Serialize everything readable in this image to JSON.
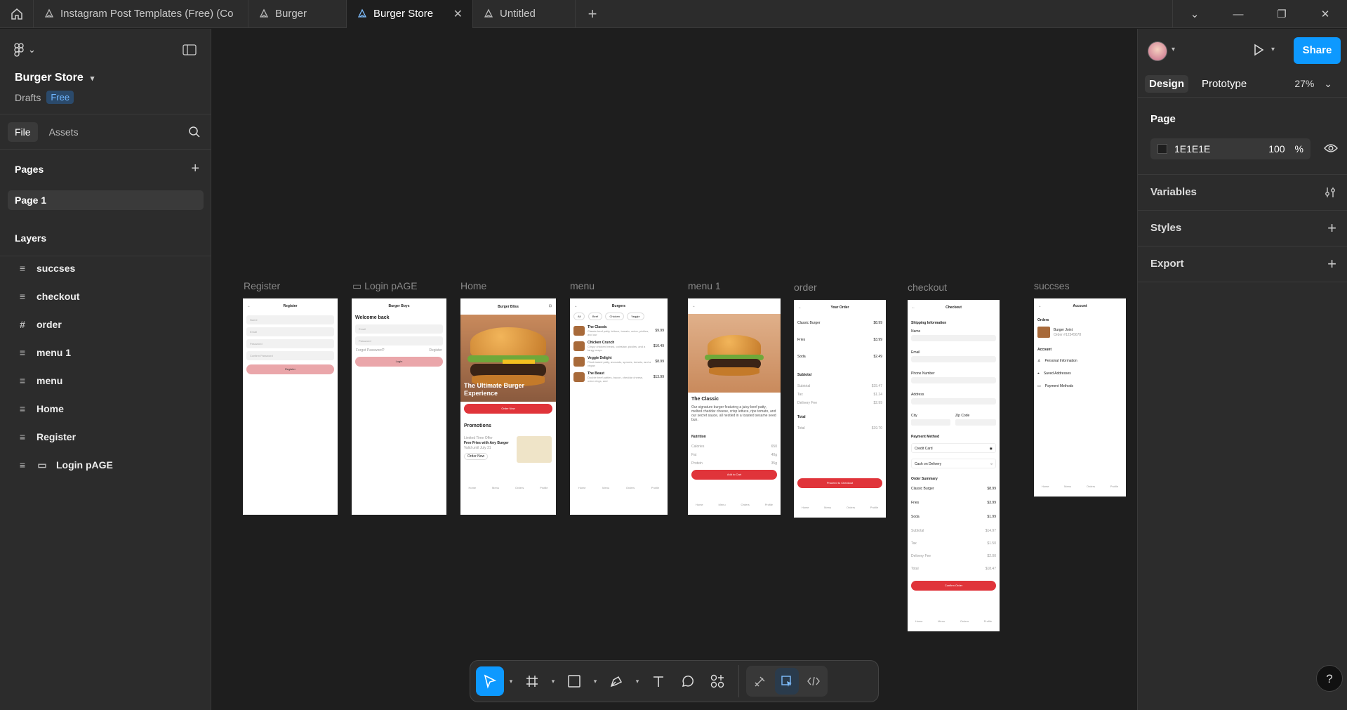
{
  "tabs": [
    {
      "label": "Instagram Post Templates (Free) (Co",
      "active": false
    },
    {
      "label": "Burger",
      "active": false
    },
    {
      "label": "Burger Store",
      "active": true
    },
    {
      "label": "Untitled",
      "active": false
    }
  ],
  "file": {
    "name": "Burger Store",
    "location": "Drafts",
    "plan": "Free"
  },
  "left_tabs": {
    "file": "File",
    "assets": "Assets"
  },
  "pages": {
    "heading": "Pages",
    "items": [
      "Page 1"
    ]
  },
  "layers": {
    "heading": "Layers",
    "items": [
      {
        "name": "succses",
        "icon": "frame-list-icon"
      },
      {
        "name": "checkout",
        "icon": "frame-list-icon"
      },
      {
        "name": "order",
        "icon": "frame-hash-icon"
      },
      {
        "name": "menu 1",
        "icon": "frame-list-icon"
      },
      {
        "name": "menu",
        "icon": "frame-list-icon"
      },
      {
        "name": "Home",
        "icon": "frame-list-icon"
      },
      {
        "name": "Register",
        "icon": "frame-list-icon"
      },
      {
        "name": "Login pAGE",
        "icon": "frame-list-icon"
      }
    ]
  },
  "canvas": {
    "frame_labels": [
      "Register",
      "Login pAGE",
      "Home",
      "menu",
      "menu 1",
      "order",
      "checkout",
      "succses"
    ],
    "register": {
      "title": "Register",
      "fields": [
        "Name",
        "Email",
        "Password",
        "Confirm Password"
      ],
      "button": "Register"
    },
    "login": {
      "brand": "Burger Boys",
      "welcome": "Welcome back",
      "fields": [
        "Email",
        "Password"
      ],
      "forgot": "Forgot Password?",
      "register": "Register",
      "button": "Login"
    },
    "home": {
      "brand": "Burger Bliss",
      "hero": "The Ultimate Burger Experience",
      "cta": "Order Now",
      "promo_heading": "Promotions",
      "promo_tag": "Limited Time Offer",
      "promo_title": "Free Fries with Any Burger",
      "promo_sub": "Valid until July 31",
      "promo_btn": "Order Now",
      "nav": [
        "Home",
        "Menu",
        "Orders",
        "Profile"
      ]
    },
    "menu": {
      "title": "Burgers",
      "chips": [
        "All",
        "Beef",
        "Chicken",
        "Veggie"
      ],
      "items": [
        {
          "name": "The Classic",
          "desc": "Classic beef patty, lettuce, tomato, onion, pickles, and our",
          "price": "$9.99"
        },
        {
          "name": "Chicken Crunch",
          "desc": "Crispy chicken breast, coleslaw, pickles, and a tangy mayo",
          "price": "$10.49"
        },
        {
          "name": "Veggie Delight",
          "desc": "Plant-based patty, avocado, sprouts, tomato, and a vegan",
          "price": "$8.99"
        },
        {
          "name": "The Beast",
          "desc": "Double beef patties, bacon, cheddar cheese, onion rings, and",
          "price": "$13.99"
        }
      ],
      "nav": [
        "Home",
        "Menu",
        "Orders",
        "Profile"
      ]
    },
    "menu1": {
      "title": "The Classic",
      "desc": "Our signature burger featuring a juicy beef patty, melted cheddar cheese, crisp lettuce, ripe tomato, and our secret sauce, all nestled in a toasted sesame seed bun.",
      "nutrition": "Nutrition",
      "rows": [
        [
          "Calories",
          "650"
        ],
        [
          "Fat",
          "40g"
        ],
        [
          "Protein",
          "35g"
        ]
      ],
      "button": "Add to Cart",
      "nav": [
        "Home",
        "Menu",
        "Orders",
        "Profile"
      ]
    },
    "order": {
      "title": "Your Order",
      "items": [
        [
          "Classic Burger",
          "$8.99"
        ],
        [
          "Fries",
          "$3.99"
        ],
        [
          "Soda",
          "$2.49"
        ]
      ],
      "subtotal_label": "Subtotal",
      "sub_rows": [
        [
          "Subtotal",
          "$15.47"
        ],
        [
          "Tax",
          "$1.24"
        ],
        [
          "Delivery Fee",
          "$2.99"
        ]
      ],
      "total_label": "Total",
      "total_row": [
        "Total",
        "$19.70"
      ],
      "button": "Proceed to Checkout",
      "nav": [
        "Home",
        "Menu",
        "Orders",
        "Profile"
      ]
    },
    "checkout": {
      "title": "Checkout",
      "shipping": "Shipping Information",
      "fields": [
        "Name",
        "Email",
        "Phone Number",
        "Address"
      ],
      "city": "City",
      "zip": "Zip Code",
      "payment": "Payment Method",
      "pay_opts": [
        "Credit Card",
        "Cash on Delivery"
      ],
      "summary": "Order Summary",
      "rows": [
        [
          "Classic Burger",
          "$8.99"
        ],
        [
          "Fries",
          "$3.99"
        ],
        [
          "Soda",
          "$1.99"
        ],
        [
          "Subtotal",
          "$14.97"
        ],
        [
          "Tax",
          "$1.50"
        ],
        [
          "Delivery Fee",
          "$2.00"
        ],
        [
          "Total",
          "$18.47"
        ]
      ],
      "button": "Confirm Order",
      "nav": [
        "Home",
        "Menu",
        "Orders",
        "Profile"
      ]
    },
    "account": {
      "title": "Account",
      "orders": "Orders",
      "order_item": "Burger Joint",
      "order_sub": "Order #12345678",
      "account": "Account",
      "links": [
        "Personal Information",
        "Saved Addresses",
        "Payment Methods"
      ],
      "nav": [
        "Home",
        "Menu",
        "Orders",
        "Profile"
      ]
    }
  },
  "right": {
    "share": "Share",
    "tabs": {
      "design": "Design",
      "prototype": "Prototype"
    },
    "zoom": "27%",
    "page": {
      "heading": "Page",
      "color": "1E1E1E",
      "opacity": "100",
      "unit": "%"
    },
    "sections": [
      "Variables",
      "Styles",
      "Export"
    ]
  },
  "colors": {
    "accent": "#0d99ff",
    "brand_red": "#e0343a",
    "canvas_bg": "#1e1e1e"
  }
}
